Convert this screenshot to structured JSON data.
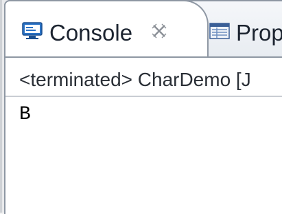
{
  "tabs": [
    {
      "label": "Console",
      "icon": "console-icon",
      "active": true,
      "close_icon": "close-icon"
    },
    {
      "label": "Prop",
      "icon": "properties-icon",
      "active": false
    }
  ],
  "console": {
    "status": "<terminated> CharDemo [J",
    "output": "B"
  },
  "colors": {
    "border": "#8e97a3",
    "icon_blue": "#2b73c6",
    "tab_active_bg": "#ffffff",
    "text": "#1c2430"
  }
}
